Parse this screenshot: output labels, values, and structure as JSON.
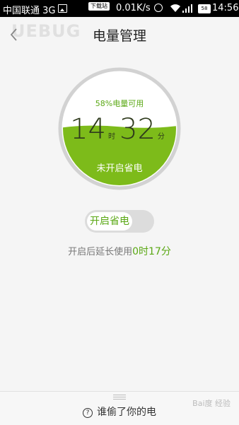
{
  "status_bar": {
    "carrier": "中国联通 3G",
    "download_badge": "下载站",
    "speed": "0.01K/s",
    "battery": "58",
    "time": "14:56"
  },
  "header": {
    "title": "电量管理",
    "watermark": "UEBUG"
  },
  "gauge": {
    "available_text": "58%电量可用",
    "hours": "14",
    "hour_unit": "时",
    "minutes": "32",
    "minute_unit": "分",
    "status": "未开启省电",
    "level": 0.58,
    "fill_color": "#7dbb1a"
  },
  "toggle": {
    "label": "开启省电",
    "state": "off"
  },
  "extend": {
    "prefix": "开启后延长使用",
    "value": "0时17分"
  },
  "footer": {
    "label": "谁偷了你的电",
    "icon": "question-circle-icon",
    "watermark": "Bai度 经验"
  },
  "colors": {
    "accent": "#5aa814",
    "background": "#f5f5f5"
  }
}
